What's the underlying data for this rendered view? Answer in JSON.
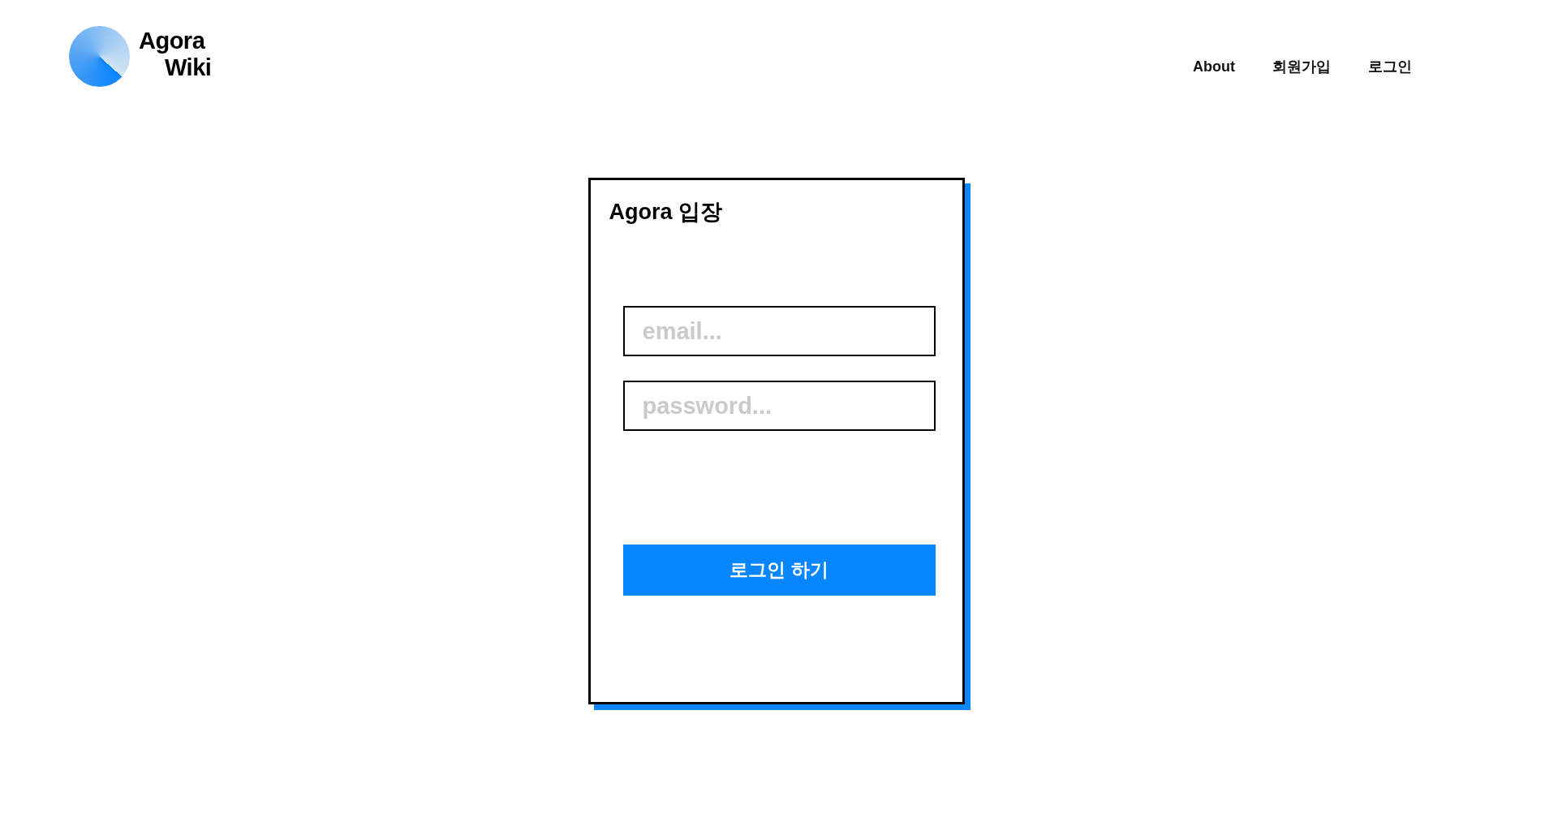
{
  "header": {
    "logo": {
      "line_1": "Agora",
      "line_2": "Wiki"
    },
    "nav": [
      {
        "label": "About"
      },
      {
        "label": "회원가입"
      },
      {
        "label": "로그인"
      }
    ]
  },
  "login_card": {
    "title": "Agora 입장",
    "fields": [
      {
        "placeholder": "email..."
      },
      {
        "placeholder": "password..."
      }
    ],
    "submit_button": "로그인 하기"
  }
}
